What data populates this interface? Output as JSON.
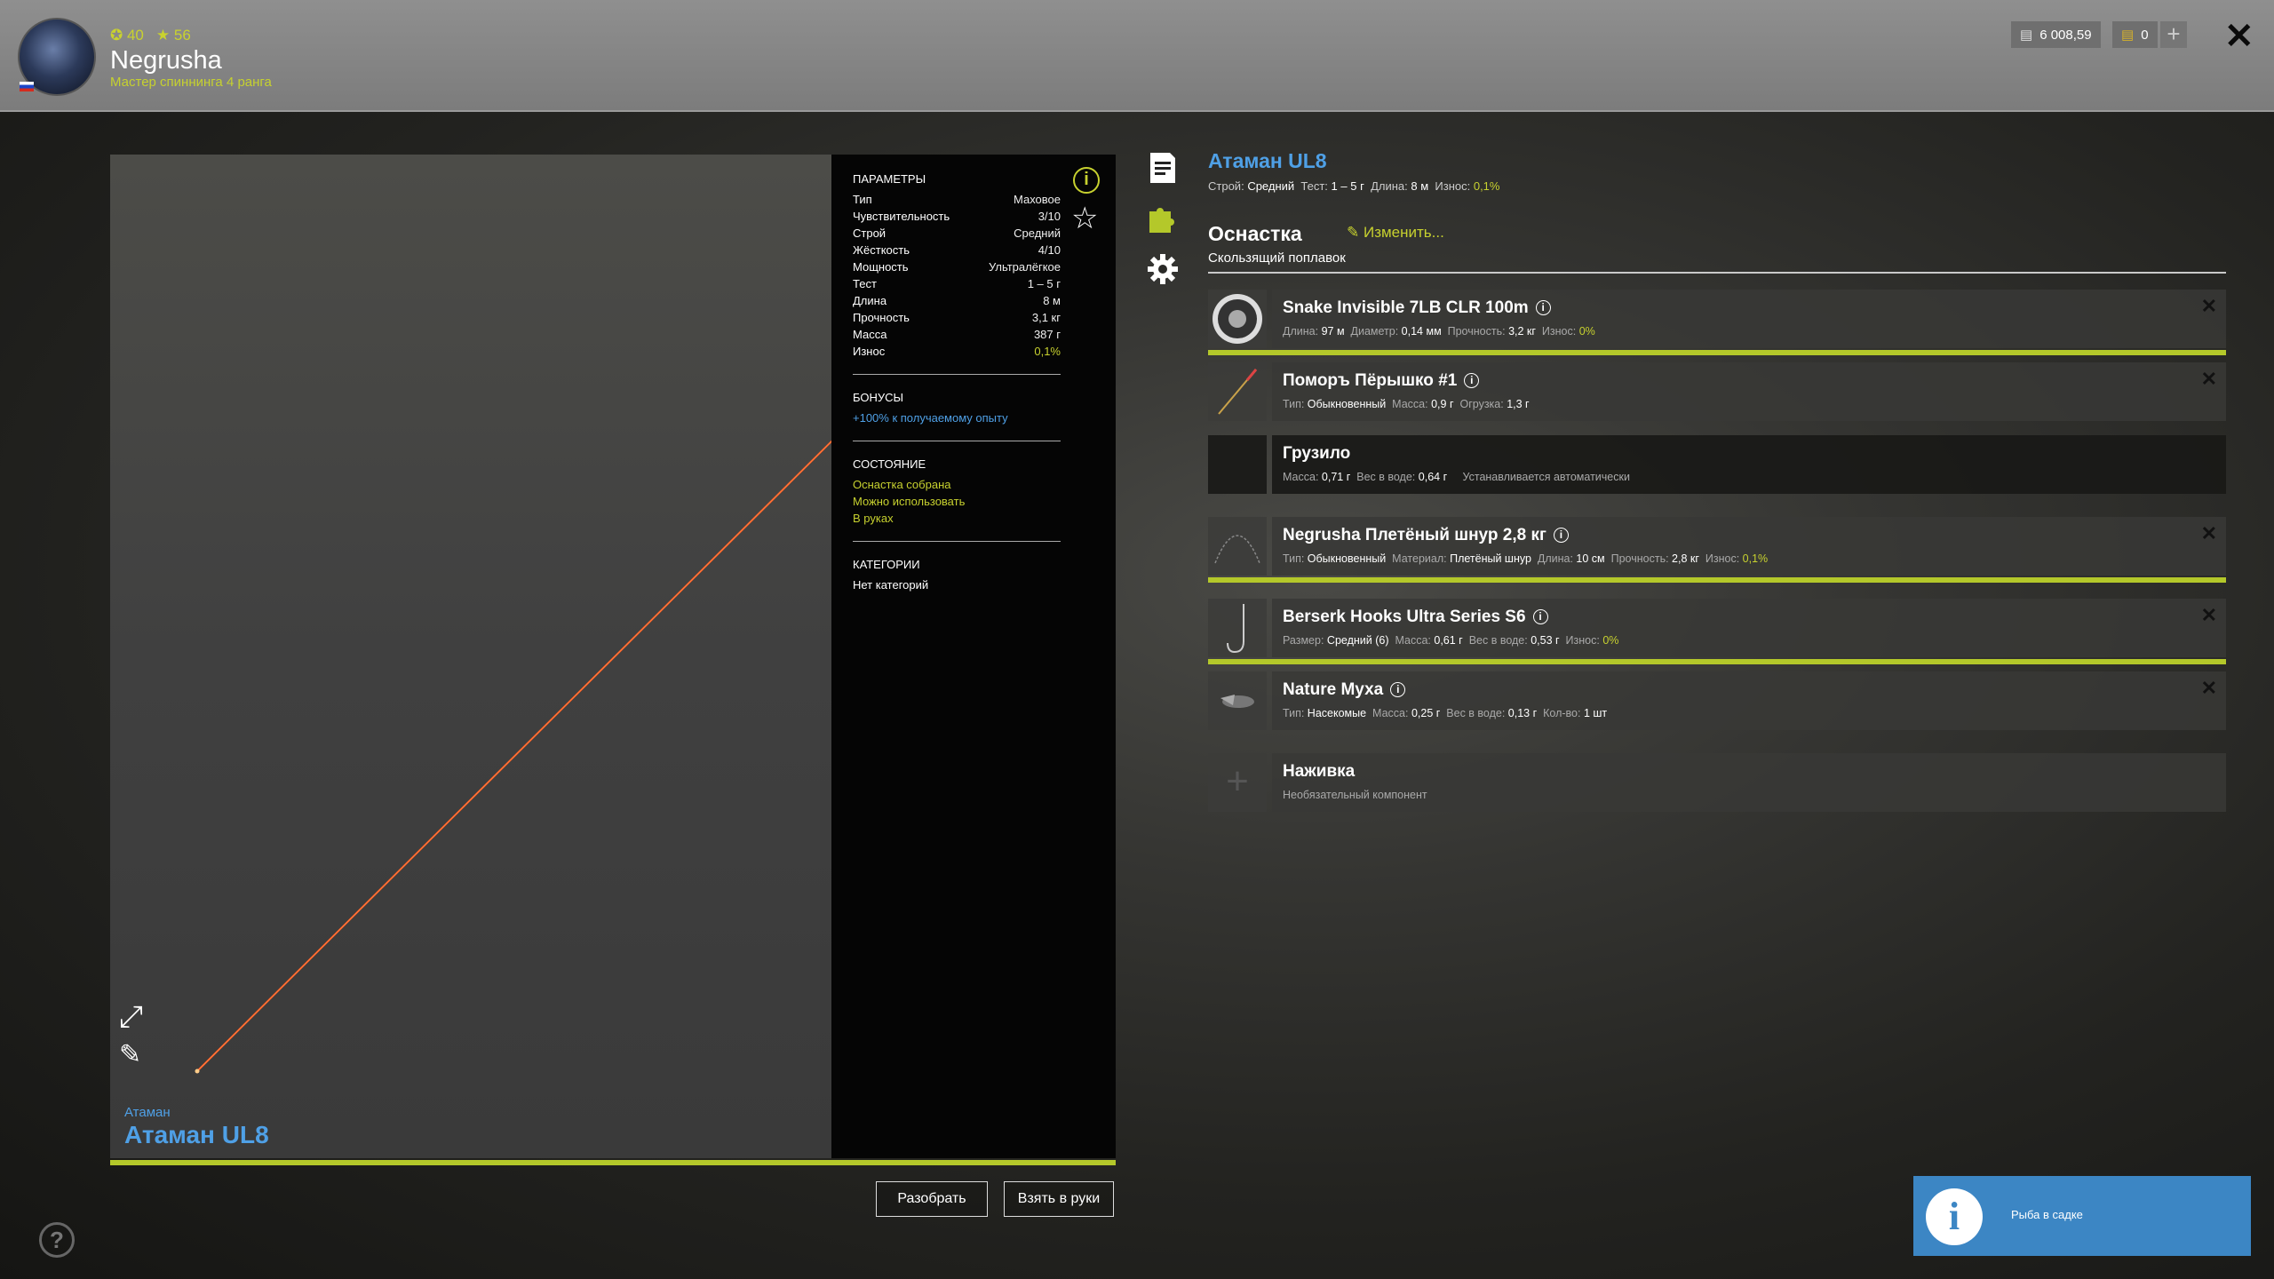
{
  "player": {
    "level": "40",
    "stars": "56",
    "name": "Negrusha",
    "title": "Мастер спиннинга 4 ранга"
  },
  "currency": {
    "silver": "6 008,59",
    "gold": "0"
  },
  "rod": {
    "brand": "Атаман",
    "name": "Атаман UL8",
    "summary": {
      "build_label": "Строй:",
      "build": "Средний",
      "test_label": "Тест:",
      "test": "1 – 5 г",
      "length_label": "Длина:",
      "length": "8 м",
      "wear_label": "Износ:",
      "wear": "0,1%"
    }
  },
  "params": {
    "title": "ПАРАМЕТРЫ",
    "rows": [
      {
        "k": "Тип",
        "v": "Маховое"
      },
      {
        "k": "Чувствительность",
        "v": "3/10"
      },
      {
        "k": "Строй",
        "v": "Средний"
      },
      {
        "k": "Жёсткость",
        "v": "4/10"
      },
      {
        "k": "Мощность",
        "v": "Ультралёгкое"
      },
      {
        "k": "Тест",
        "v": "1 – 5 г"
      },
      {
        "k": "Длина",
        "v": "8 м"
      },
      {
        "k": "Прочность",
        "v": "3,1 кг"
      },
      {
        "k": "Масса",
        "v": "387 г"
      },
      {
        "k": "Износ",
        "v": "0,1%"
      }
    ],
    "bonus_title": "БОНУСЫ",
    "bonus": "+100% к получаемому опыту",
    "state_title": "СОСТОЯНИЕ",
    "state": [
      "Оснастка собрана",
      "Можно использовать",
      "В руках"
    ],
    "cat_title": "КАТЕГОРИИ",
    "cat": "Нет категорий"
  },
  "rig": {
    "title": "Оснастка",
    "edit": "Изменить...",
    "type": "Скользящий поплавок"
  },
  "slots": [
    {
      "name": "Snake Invisible 7LB CLR 100m",
      "d": [
        [
          "Длина:",
          "97 м"
        ],
        [
          "Диаметр:",
          "0,14 мм"
        ],
        [
          "Прочность:",
          "3,2 кг"
        ]
      ],
      "wear": [
        "Износ:",
        "0%"
      ]
    },
    {
      "name": "Поморъ Пёрышко #1",
      "d": [
        [
          "Тип:",
          "Обыкновенный"
        ],
        [
          "Масса:",
          "0,9 г"
        ],
        [
          "Огрузка:",
          "1,3 г"
        ]
      ]
    },
    {
      "name": "Грузило",
      "d": [
        [
          "Масса:",
          "0,71 г"
        ],
        [
          "Вес в воде:",
          "0,64 г"
        ]
      ],
      "note": "Устанавливается автоматически"
    },
    {
      "name": "Negrusha Плетёный шнур 2,8 кг",
      "d": [
        [
          "Тип:",
          "Обыкновенный"
        ],
        [
          "Материал:",
          "Плетёный шнур"
        ],
        [
          "Длина:",
          "10 см"
        ],
        [
          "Прочность:",
          "2,8 кг"
        ]
      ],
      "wear": [
        "Износ:",
        "0,1%"
      ]
    },
    {
      "name": "Berserk Hooks Ultra Series S6",
      "d": [
        [
          "Размер:",
          "Средний (6)"
        ],
        [
          "Масса:",
          "0,61 г"
        ],
        [
          "Вес в воде:",
          "0,53 г"
        ]
      ],
      "wear": [
        "Износ:",
        "0%"
      ]
    },
    {
      "name": "Nature Муха",
      "d": [
        [
          "Тип:",
          "Насекомые"
        ],
        [
          "Масса:",
          "0,25 г"
        ],
        [
          "Вес в воде:",
          "0,13 г"
        ],
        [
          "Кол-во:",
          "1 шт"
        ]
      ]
    },
    {
      "name": "Наживка",
      "note": "Необязательный компонент"
    }
  ],
  "buttons": {
    "disassemble": "Разобрать",
    "take": "Взять в руки"
  },
  "notification": "Рыба в садке",
  "colors": {
    "accent_green": "#b4c82a",
    "accent_blue": "#4fa0e6"
  }
}
